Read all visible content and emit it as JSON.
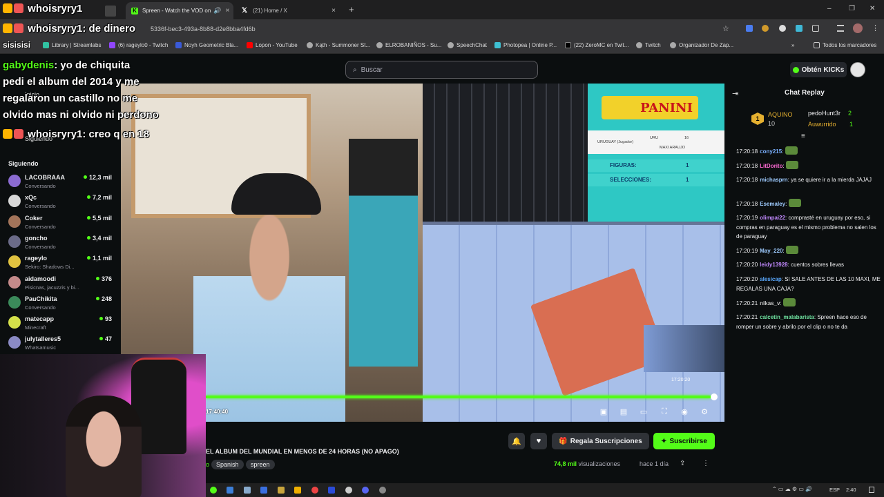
{
  "browser": {
    "tabs": [
      {
        "title": "",
        "close": ""
      },
      {
        "title": "Spreen - Watch the VOD on",
        "close": "×"
      },
      {
        "title": "(21) Home / X",
        "close": "×"
      }
    ],
    "new_tab": "+",
    "url": "5336f-bec3-493a-8b88-d2e8bba4fd6b",
    "bookmarks": [
      "Library | Streamlabs",
      "(6) rageylo0 - Twitch",
      "Noyh Geometric Bla...",
      "Lopon - YouTube",
      "Kąth - Summoner St...",
      "ELROBANIÑOS - Su...",
      "SpeechChat",
      "Photopea | Online P...",
      "(22) ZeroMC en Twit...",
      "Twitch",
      "Organizador De Zap..."
    ],
    "bookmarks_folder": "Todos los marcadores",
    "win_min": "–",
    "win_max": "❐",
    "win_close": "✕"
  },
  "overlay": {
    "line1_user": "whoisryry1",
    "line1_tag": "",
    "line2_user": "whoisryry1",
    "line2_text": ": de dinero",
    "line3": "sisisisi",
    "gabydenis_user": "gabydenis",
    "gabydenis_text": ": yo de chiquita",
    "gaby_line2": "pedi el album del 2014 y me",
    "gaby_line3": "regalaron un castillo no me",
    "gaby_line4": "olvido mas ni olvido ni perdono",
    "line_last_user": "whoisryry1",
    "line_last_text": ": creo q en 18"
  },
  "kick": {
    "logo": "KICK",
    "search_placeholder": "Buscar",
    "kicks_button": "Obtén KICKs",
    "nav_inicio": "Inicio",
    "nav_siguiendo": "Siguiendo",
    "following_header": "Siguiendo",
    "following": [
      {
        "name": "LACOBRAAA",
        "sub": "Conversando",
        "count": "12,3 mil",
        "color": "#8b6bd1"
      },
      {
        "name": "xQc",
        "sub": "Conversando",
        "count": "7,2 mil",
        "color": "#d8d8d8"
      },
      {
        "name": "Coker",
        "sub": "Conversando",
        "count": "5,5 mil",
        "color": "#a3745a"
      },
      {
        "name": "goncho",
        "sub": "Conversando",
        "count": "3,4 mil",
        "color": "#6b6b88"
      },
      {
        "name": "rageylo",
        "sub": "Sekiro: Shadows Di...",
        "count": "1,1 mil",
        "color": "#e0c240"
      },
      {
        "name": "aidamoodi",
        "sub": "Pisicnas, jacuzzis y bi...",
        "count": "376",
        "color": "#c48a8a"
      },
      {
        "name": "PauChikita",
        "sub": "Conversando",
        "count": "248",
        "color": "#3b8a5a"
      },
      {
        "name": "matecapp",
        "sub": "Minecraft",
        "count": "93",
        "color": "#d4e04a"
      },
      {
        "name": "julytalleres5",
        "sub": "Whatsamusic",
        "count": "47",
        "color": "#8a8ac4"
      }
    ]
  },
  "video": {
    "time": "17:40:40",
    "progress": 0.99,
    "panini_logo": "PANINI",
    "panini_player": "URUGUAY (Jugador)",
    "panini_code": "URU",
    "panini_num": "16",
    "panini_name": "MAXI ARAUJO",
    "panini_fig_label": "FIGURAS:",
    "panini_fig_value": "1",
    "panini_sel_label": "SELECCIONES:",
    "panini_sel_value": "1",
    "pip_time": "17:20:20"
  },
  "stream": {
    "title": "EL ALBUM DEL MUNDIAL EN MENOS DE 24 HORAS (NO APAGO)",
    "tag_prefix": "o",
    "tags": [
      "Spanish",
      "spreen"
    ],
    "gift_button": "Regala Suscripciones",
    "subscribe_button": "Suscribirse",
    "views_number": "74,8 mil",
    "views_label": " visualizaciones",
    "ago": "hace 1 día"
  },
  "chat": {
    "title": "Chat Replay",
    "leader1_name": "AQUINO",
    "leader1_count": "10",
    "leader2_name": "pedoHunt3r",
    "leader2_count": "2",
    "leader3_name": "Auwurrido",
    "leader3_count": "1",
    "messages": [
      {
        "ts": "17:20:18",
        "user": "cony215",
        "text": "",
        "color": "#7ab0ff",
        "emote": true
      },
      {
        "ts": "17:20:18",
        "user": "LitDorito",
        "text": "",
        "color": "#ff6ad5",
        "emote": true
      },
      {
        "ts": "17:20:18",
        "user": "michasprn",
        "text": " ya se quiere ir a la mierda JAJAJ",
        "color": "#9ecbff",
        "emote": false
      },
      {
        "ts": "17:20:18",
        "user": "Esemaley",
        "text": "",
        "color": "#9ecbff",
        "emote": true
      },
      {
        "ts": "17:20:19",
        "user": "olimpai22",
        "text": " comprasté en uruguay por eso, si compras en paraguay es el mismo problema no salen los de paraguay",
        "color": "#c28aff",
        "emote": false
      },
      {
        "ts": "17:20:19",
        "user": "May_220",
        "text": "",
        "color": "#9ecbff",
        "emote": true
      },
      {
        "ts": "17:20:20",
        "user": "leidy13928",
        "text": " cuentos sobres llevas",
        "color": "#c28aff",
        "emote": false
      },
      {
        "ts": "17:20:20",
        "user": "alesicap",
        "text": " SI SALE ANTES DE LAS 10 MAXI, ME REGALAS UNA CAJA?",
        "color": "#5aa9ff",
        "emote": false
      },
      {
        "ts": "17:20:21",
        "user": "nikas_v",
        "text": "",
        "color": "#c7c7c7",
        "emote": true
      },
      {
        "ts": "17:20:21",
        "user": "calcetin_malabarista",
        "text": " Spreen hace eso de romper un sobre y abrilo por el clip o no te da",
        "color": "#6fe2a0",
        "emote": false
      }
    ]
  },
  "taskbar": {
    "lang": "ESP",
    "clock": "2:40"
  },
  "colors": {
    "accent": "#53fc18",
    "background": "#0b0e0f",
    "panel": "#2f3237"
  }
}
